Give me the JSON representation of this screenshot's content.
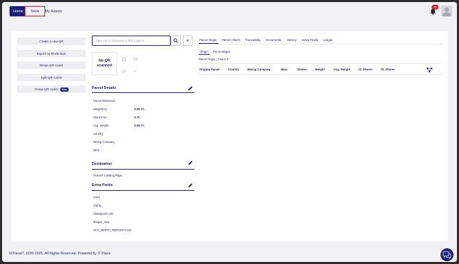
{
  "nav": {
    "home": "Home",
    "tools": "Tools",
    "my_assets": "My Assets",
    "notification_count": "20"
  },
  "sidebar": {
    "items": [
      {
        "label": "Create a new QR"
      },
      {
        "label": "Export on blockchain"
      },
      {
        "label": "Merge QR codes"
      },
      {
        "label": "Split QR codes"
      },
      {
        "label": "Group QR codes",
        "badge": "New"
      }
    ]
  },
  "search": {
    "placeholder": "Type min 3 characters to find a parcel"
  },
  "qr": {
    "status": "No QR scanned"
  },
  "parcel_details": {
    "title": "Parcel Details",
    "fields": [
      {
        "label": "Parcel Reference",
        "value": ""
      },
      {
        "label": "Weight(Ct)",
        "value": "0.00 Ct."
      },
      {
        "label": "Stones No.",
        "value": "0 St."
      },
      {
        "label": "Avg. Weight",
        "value": "0.00 Ct."
      },
      {
        "label": "Country",
        "value": ""
      },
      {
        "label": "Mining Company",
        "value": ""
      },
      {
        "label": "Mine",
        "value": ""
      }
    ]
  },
  "destination": {
    "title": "Destination",
    "fields": [
      {
        "label": "iTraceiT Landing Page"
      }
    ]
  },
  "extra_fields": {
    "title": "Extra Fields",
    "fields": [
      {
        "label": "Color"
      },
      {
        "label": "Clarity"
      },
      {
        "label": "Sharepoint Link"
      },
      {
        "label": "shapes_new"
      },
      {
        "label": "SCS_DEPTH_PERCENTAGE"
      }
    ]
  },
  "tabs": [
    "Parcel Origin",
    "Parcel Child's",
    "Traceability",
    "Documents",
    "History",
    "Extra Fields",
    "Ledger"
  ],
  "subtabs": [
    "Origin",
    "Percentages"
  ],
  "origin_count": "Parcel Origin | Count: 0",
  "table": {
    "headers": [
      "Original Parcel",
      "Country",
      "Mining Company",
      "Mine",
      "Stones",
      "Weight",
      "Avg. Weight",
      "Ct. Shares",
      "St. Shares"
    ]
  },
  "footer": {
    "text": "©iTraceiT, 2020-2025. All Rights Reserved. Powered by ",
    "link": "IT Place"
  },
  "colors": {
    "primary": "#1b1f7a",
    "alert": "#e0101e"
  }
}
